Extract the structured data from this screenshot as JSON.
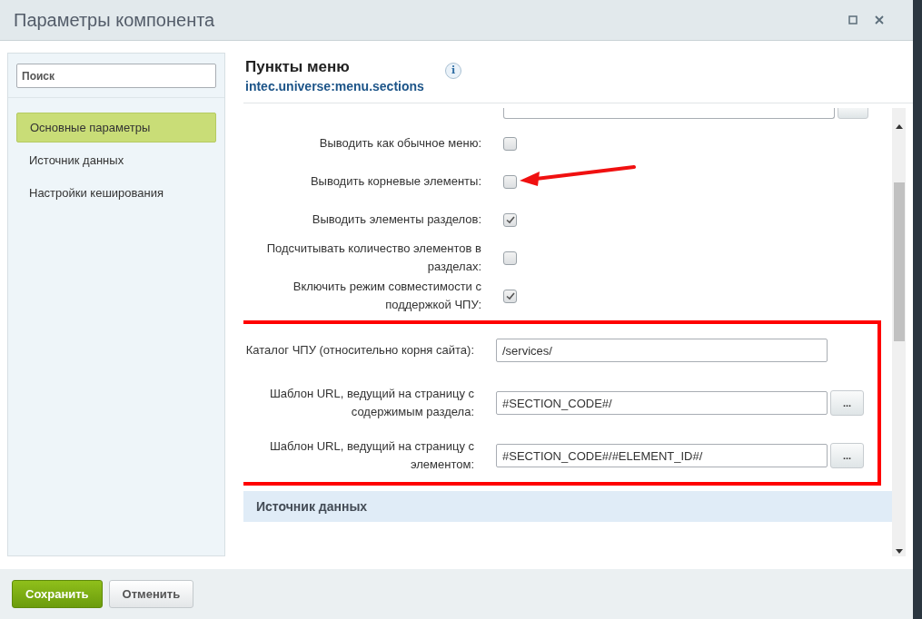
{
  "window": {
    "title": "Параметры компонента"
  },
  "sidebar": {
    "search": {
      "placeholder": "Поиск"
    },
    "items": [
      {
        "label": "Основные параметры",
        "selected": true
      },
      {
        "label": "Источник данных",
        "selected": false
      },
      {
        "label": "Настройки кеширования",
        "selected": false
      }
    ]
  },
  "component": {
    "title": "Пункты меню",
    "code": "intec.universe:menu.sections",
    "info": "i"
  },
  "params": [
    {
      "kind": "checkbox",
      "label": "Выводить как обычное меню:",
      "checked": false
    },
    {
      "kind": "checkbox",
      "label": "Выводить корневые элементы:",
      "checked": false,
      "annotated": true
    },
    {
      "kind": "checkbox",
      "label": "Выводить элементы разделов:",
      "checked": true
    },
    {
      "kind": "checkbox",
      "label": "Подсчитывать количество элементов в разделах:",
      "checked": false
    },
    {
      "kind": "checkbox",
      "label": "Включить режим совместимости с поддержкой ЧПУ:",
      "checked": true
    }
  ],
  "highlighted_params": [
    {
      "kind": "text",
      "label": "Каталог ЧПУ (относительно корня сайта):",
      "value": "/services/"
    },
    {
      "kind": "text_button",
      "label": "Шаблон URL, ведущий на страницу с содержимым раздела:",
      "value": "#SECTION_CODE#/",
      "button": "..."
    },
    {
      "kind": "text_button",
      "label": "Шаблон URL, ведущий на страницу с элементом:",
      "value": "#SECTION_CODE#/#ELEMENT_ID#/",
      "button": "..."
    }
  ],
  "section_header": "Источник данных",
  "buttons": [
    {
      "label": "Сохранить",
      "kind": "primary"
    },
    {
      "label": "Отменить",
      "kind": "secondary"
    }
  ]
}
